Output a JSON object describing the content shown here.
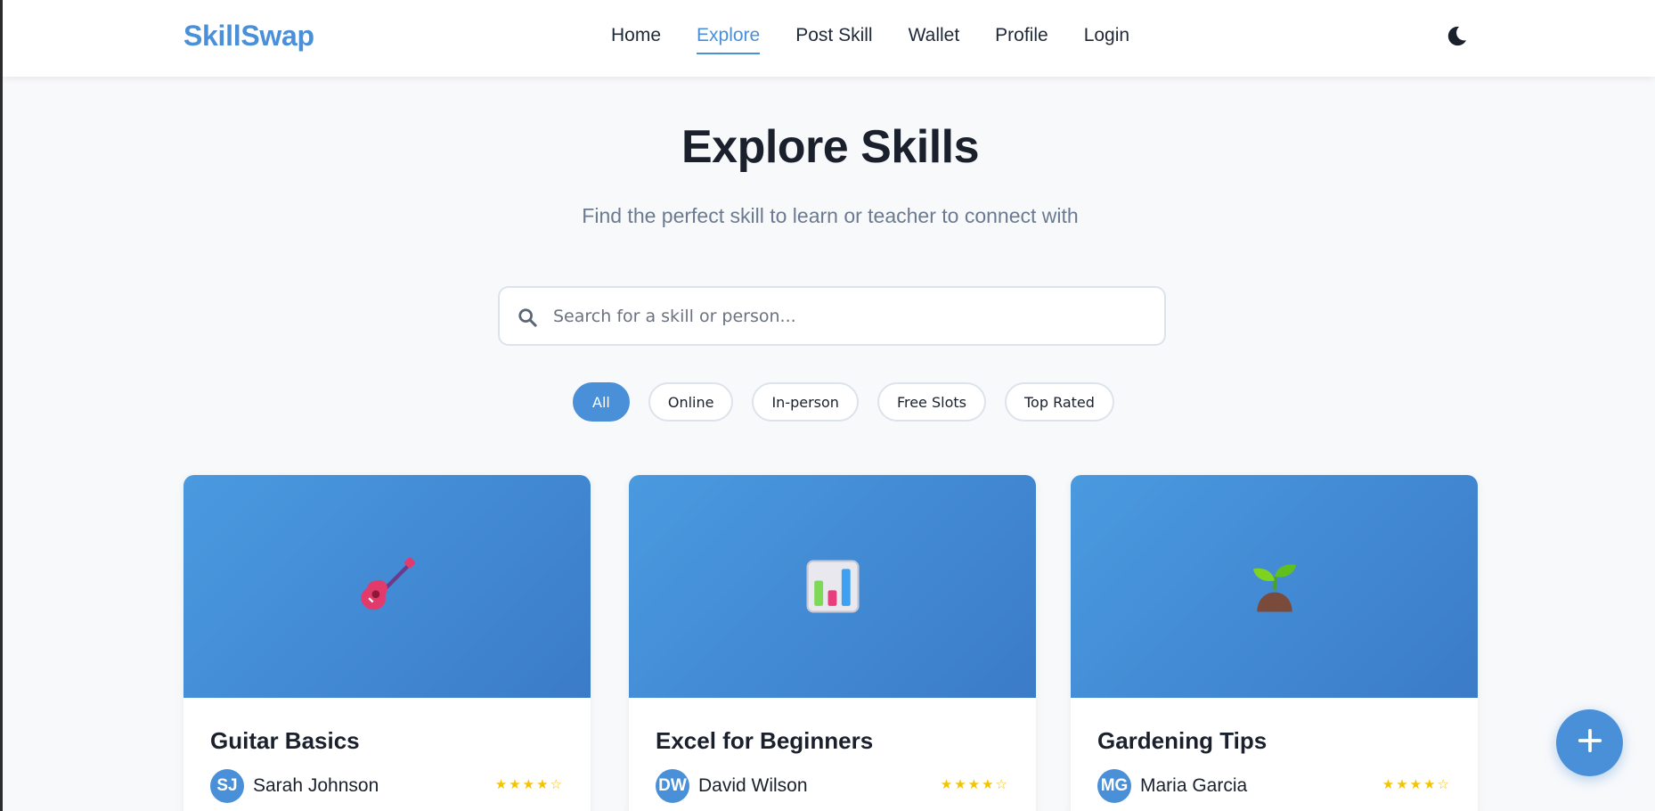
{
  "brand": "SkillSwap",
  "nav": {
    "items": [
      {
        "label": "Home",
        "active": false
      },
      {
        "label": "Explore",
        "active": true
      },
      {
        "label": "Post Skill",
        "active": false
      },
      {
        "label": "Wallet",
        "active": false
      },
      {
        "label": "Profile",
        "active": false
      },
      {
        "label": "Login",
        "active": false
      }
    ],
    "theme_icon": "moon-icon"
  },
  "hero": {
    "title": "Explore Skills",
    "subtitle": "Find the perfect skill to learn or teacher to connect with"
  },
  "search": {
    "placeholder": "Search for a skill or person...",
    "value": "",
    "icon": "search-icon"
  },
  "filters": [
    {
      "label": "All",
      "active": true
    },
    {
      "label": "Online",
      "active": false
    },
    {
      "label": "In-person",
      "active": false
    },
    {
      "label": "Free Slots",
      "active": false
    },
    {
      "label": "Top Rated",
      "active": false
    }
  ],
  "cards": [
    {
      "title": "Guitar Basics",
      "icon": "guitar-icon",
      "owner": "Sarah Johnson",
      "initials": "SJ",
      "rating": 4,
      "rating_text": "★★★★☆"
    },
    {
      "title": "Excel for Beginners",
      "icon": "bar-chart-icon",
      "owner": "David Wilson",
      "initials": "DW",
      "rating": 4,
      "rating_text": "★★★★☆"
    },
    {
      "title": "Gardening Tips",
      "icon": "seedling-icon",
      "owner": "Maria Garcia",
      "initials": "MG",
      "rating": 4,
      "rating_text": "★★★★☆"
    }
  ],
  "fab": {
    "icon": "plus-icon"
  },
  "colors": {
    "accent": "#4a90d9",
    "star": "#f5c400",
    "text": "#1a202c",
    "muted": "#6b7a90"
  }
}
